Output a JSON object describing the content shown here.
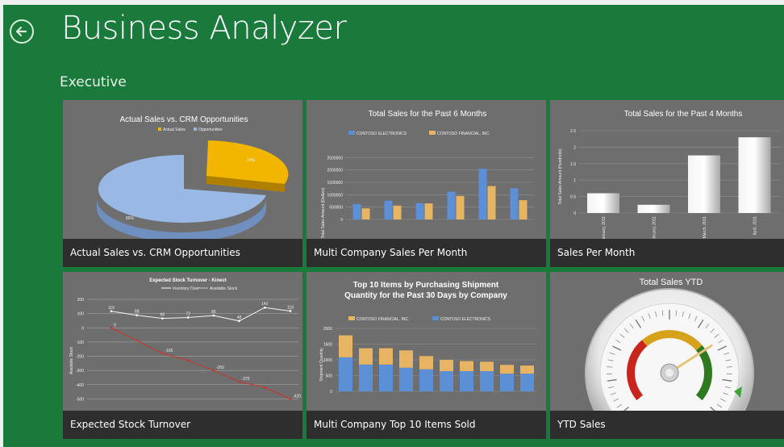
{
  "app": {
    "title": "Business Analyzer",
    "section": "Executive"
  },
  "colors": {
    "background": "#1a7a3c",
    "tile": "#6e6e6e",
    "caption_bar": "#2e2e2e",
    "series_blue": "#5b8fd6",
    "series_orange": "#e6b462",
    "pie_yellow": "#f2b600",
    "pie_blue": "#9ab8e4"
  },
  "tiles": [
    {
      "caption": "Actual Sales vs. CRM Opportunities",
      "chart_data": {
        "type": "pie",
        "title": "Actual Sales vs. CRM Opportunities",
        "legend": [
          "Actual Sales",
          "Opportunities"
        ],
        "legend_position": "top",
        "slices": [
          {
            "name": "Actual Sales",
            "value": 14,
            "label": "14%"
          },
          {
            "name": "Opportunities",
            "value": 86,
            "label": "86%"
          }
        ]
      }
    },
    {
      "caption": "Multi Company Sales Per Month",
      "chart_data": {
        "type": "bar",
        "title": "Total Sales for the Past 6 Months",
        "ylabel": "Total Sales Amount (Dollars)",
        "legend_position": "top",
        "ylim": [
          0,
          3000000
        ],
        "yticks": [
          "0",
          "500000",
          "1000000",
          "1500000",
          "2000000",
          "2500000"
        ],
        "categories": [
          "",
          "",
          "",
          "",
          "",
          ""
        ],
        "series": [
          {
            "name": "CONTOSO ELECTRONICS",
            "values": [
              620000,
              760000,
              660000,
              1120000,
              2050000,
              1260000
            ]
          },
          {
            "name": "CONTOSO FINANCIAL, INC.",
            "values": [
              450000,
              560000,
              650000,
              950000,
              1350000,
              780000
            ]
          }
        ]
      }
    },
    {
      "caption": "Sales Per Month",
      "chart_data": {
        "type": "bar",
        "title": "Total Sales for the Past 4 Months",
        "ylabel": "Total Sales Amount (Hundreds)",
        "ylim": [
          0,
          2.5
        ],
        "yticks": [
          "0",
          "0.5",
          "1",
          "1.5",
          "2",
          "2.5"
        ],
        "categories": [
          "January, 2011",
          "February, 2011",
          "March, 2011",
          "April, 2011"
        ],
        "values": [
          0.6,
          0.25,
          1.75,
          2.3
        ]
      }
    },
    {
      "caption": "Expected Stock Turnover",
      "chart_data": {
        "type": "line",
        "title": "Expected Stock Turnover - Kinect",
        "ylabel": "Available Stock",
        "legend": [
          "Inventory Over",
          "Available Stock"
        ],
        "ylim": [
          -600,
          200
        ],
        "yticks": [
          "200",
          "100",
          "0",
          "-100",
          "-200",
          "-300",
          "-400",
          "-500",
          "-600"
        ],
        "series": [
          {
            "name": "Inventory Over",
            "values": [
              116,
              88,
              66,
              72,
              86,
              48,
              142,
              118
            ]
          },
          {
            "name": "Available Stock",
            "values": [
              0,
              -90,
              -180,
              -230,
              -300,
              -380,
              -420,
              -500
            ]
          }
        ],
        "data_labels": [
          "116",
          "88",
          "66",
          "72",
          "86",
          "48",
          "142",
          "118"
        ],
        "red_labels": [
          "0",
          "-165",
          "-265",
          "-370",
          "-420"
        ]
      }
    },
    {
      "caption": "Multi Company Top 10 Items Sold",
      "chart_data": {
        "type": "bar",
        "stacked": true,
        "title": "Top 10 Items by Purchasing Shipment Quantity for the Past 30 Days by Company",
        "ylabel": "Shipment Quantity",
        "ylim": [
          0,
          2000
        ],
        "yticks": [
          "0",
          "500",
          "1000",
          "1500",
          "2000"
        ],
        "categories": [
          "",
          "",
          "",
          "",
          "",
          "",
          "",
          "",
          "",
          ""
        ],
        "series": [
          {
            "name": "CONTOSO ELECTRONICS",
            "values": [
              1080,
              850,
              850,
              750,
              700,
              640,
              640,
              640,
              560,
              560
            ]
          },
          {
            "name": "CONTOSO FINANCIAL, INC.",
            "values": [
              700,
              520,
              520,
              550,
              420,
              360,
              320,
              300,
              280,
              260
            ]
          }
        ]
      }
    },
    {
      "caption": "YTD Sales",
      "chart_data": {
        "type": "gauge",
        "title": "Total Sales YTD",
        "value_fraction": 0.72
      }
    }
  ]
}
